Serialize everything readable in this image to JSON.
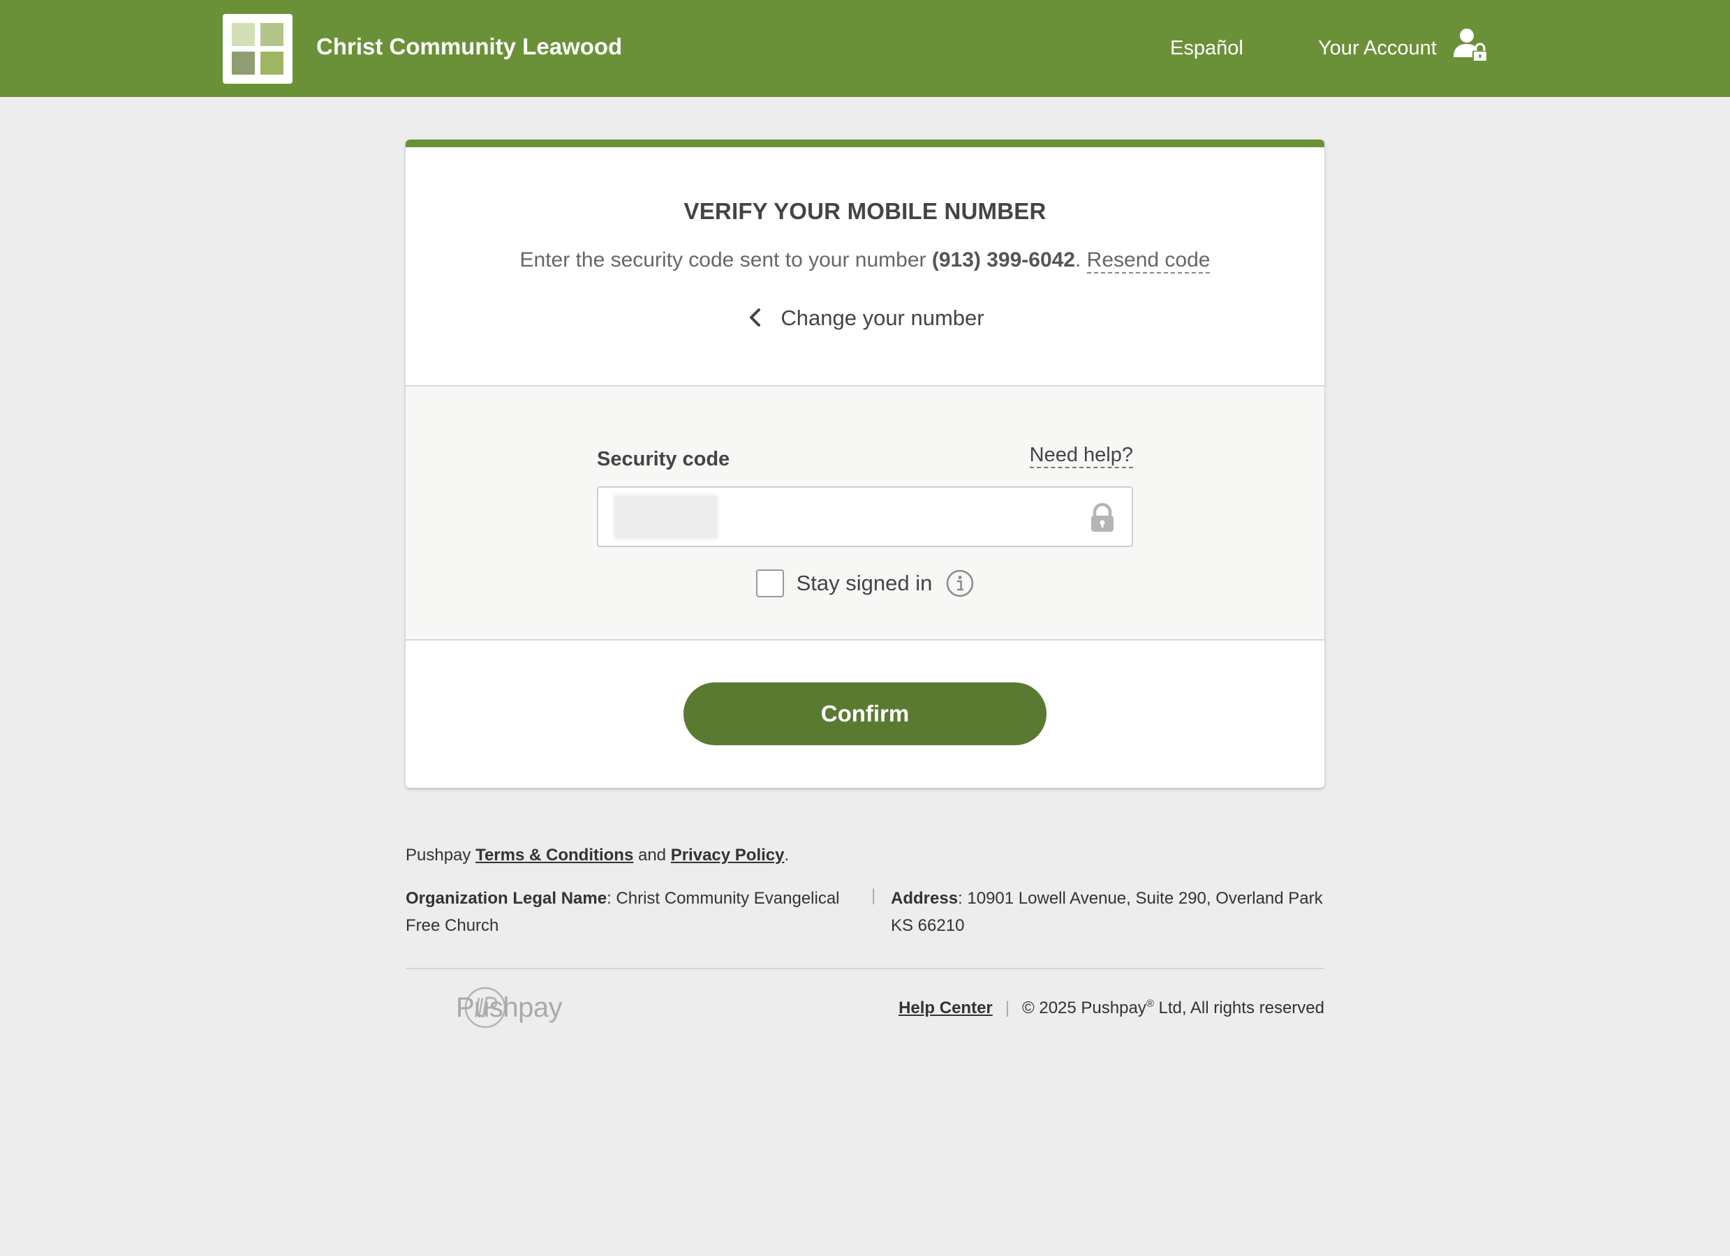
{
  "header": {
    "site_title": "Christ Community Leawood",
    "language_link": "Español",
    "account_link": "Your Account",
    "brand_color": "#6b9138"
  },
  "verify": {
    "title": "VERIFY YOUR MOBILE NUMBER",
    "instruction_prefix": "Enter the security code sent to your number ",
    "phone_number": "(913) 399-6042",
    "instruction_suffix": ". ",
    "resend_label": "Resend code",
    "change_number_label": "Change your number"
  },
  "form": {
    "code_label": "Security code",
    "need_help_label": "Need help?",
    "code_value": "",
    "stay_signed_in_label": "Stay signed in",
    "stay_signed_in_checked": false,
    "confirm_label": "Confirm",
    "button_color": "#5a7a31"
  },
  "footer": {
    "legal_prefix": "Pushpay ",
    "terms_label": "Terms & Conditions",
    "and_text": " and ",
    "privacy_label": "Privacy Policy",
    "period": ".",
    "org_label": "Organization Legal Name",
    "org_value": ": Christ Community Evangelical Free Church",
    "address_sep": "|",
    "address_label": "Address",
    "address_value": ": 10901 Lowell Avenue, Suite 290, Overland Park KS 66210",
    "brand_name": "Pushpay",
    "help_center_label": "Help Center",
    "bottom_sep": "|",
    "copyright_prefix": "© 2025 Pushpay",
    "registered_mark": "®",
    "copyright_suffix": " Ltd, All rights reserved"
  }
}
